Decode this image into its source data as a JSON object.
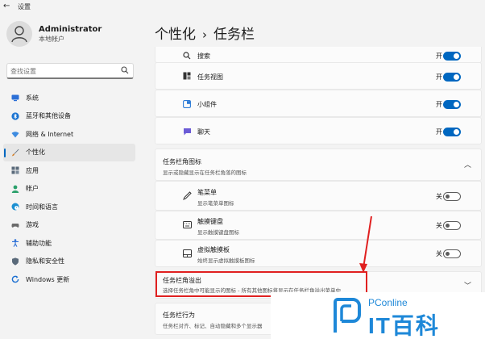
{
  "window": {
    "title": "设置",
    "back_icon": "back-arrow-icon"
  },
  "profile": {
    "name": "Administrator",
    "subtitle": "本地帐户"
  },
  "search": {
    "placeholder": "查找设置"
  },
  "nav": [
    {
      "label": "系统",
      "icon": "system-icon",
      "color": "#2b6fd6"
    },
    {
      "label": "蓝牙和其他设备",
      "icon": "bluetooth-icon",
      "color": "#1a73d1"
    },
    {
      "label": "网络 & Internet",
      "icon": "network-icon",
      "color": "#3d8be0"
    },
    {
      "label": "个性化",
      "icon": "brush-icon",
      "color": "#d6822b",
      "active": true
    },
    {
      "label": "应用",
      "icon": "apps-icon",
      "color": "#5a6a7a"
    },
    {
      "label": "帐户",
      "icon": "account-icon",
      "color": "#2aa06b"
    },
    {
      "label": "时间和语言",
      "icon": "globe-clock-icon",
      "color": "#1b8fd1"
    },
    {
      "label": "游戏",
      "icon": "gamepad-icon",
      "color": "#6b6b6b"
    },
    {
      "label": "辅助功能",
      "icon": "accessibility-icon",
      "color": "#2b6fd6"
    },
    {
      "label": "隐私和安全性",
      "icon": "shield-icon",
      "color": "#5a6a7a"
    },
    {
      "label": "Windows 更新",
      "icon": "update-icon",
      "color": "#1b6fd1"
    }
  ],
  "breadcrumb": {
    "parent": "个性化",
    "separator": "›",
    "current": "任务栏"
  },
  "taskbar_items": [
    {
      "label": "搜索",
      "icon": "search-icon",
      "state": "开",
      "on": true
    },
    {
      "label": "任务视图",
      "icon": "task-view-icon",
      "state": "开",
      "on": true
    },
    {
      "label": "小组件",
      "icon": "widgets-icon",
      "state": "开",
      "on": true
    },
    {
      "label": "聊天",
      "icon": "chat-icon",
      "state": "开",
      "on": true
    }
  ],
  "corner_icons": {
    "title": "任务栏角图标",
    "desc": "显示或隐藏显示在任务栏角落的图标",
    "items": [
      {
        "label": "笔菜单",
        "desc": "显示笔菜单图标",
        "icon": "pen-icon",
        "state": "关",
        "on": false
      },
      {
        "label": "触摸键盘",
        "desc": "显示触摸键盘图标",
        "icon": "keyboard-icon",
        "state": "关",
        "on": false
      },
      {
        "label": "虚拟触摸板",
        "desc": "始终显示虚拟触摸板图标",
        "icon": "touchpad-icon",
        "state": "关",
        "on": false
      }
    ]
  },
  "overflow": {
    "title": "任务栏角溢出",
    "desc": "选择任务栏角中可能显示的图标 - 所有其他图标将显示在任务栏角溢出菜单中"
  },
  "behaviors": {
    "title": "任务栏行为",
    "desc": "任务栏对齐、标记、自动隐藏和多个显示器"
  },
  "watermark": {
    "latin": "PConline",
    "cjk": "IT百科"
  },
  "colors": {
    "accent": "#0067c0",
    "highlight": "#e02020",
    "watermark": "#1e88d8"
  }
}
